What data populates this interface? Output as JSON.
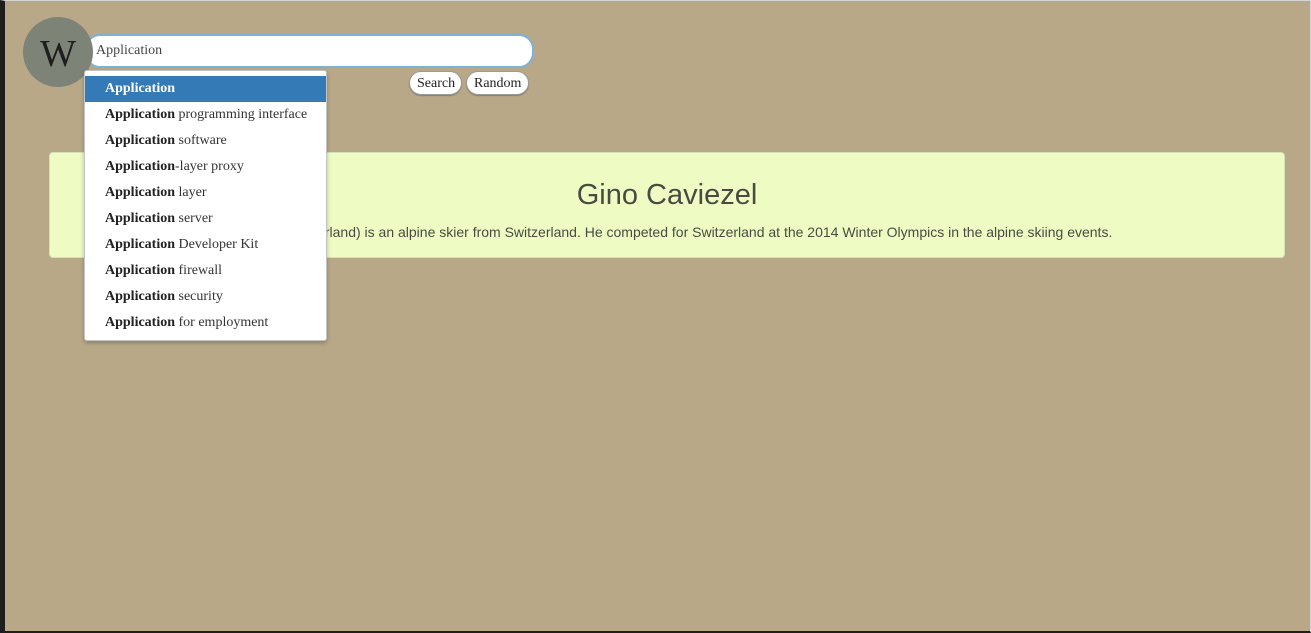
{
  "logo": {
    "letter": "W"
  },
  "search": {
    "value": "Application",
    "search_label": "Search",
    "random_label": "Random"
  },
  "autocomplete": {
    "items": [
      {
        "match": "Application",
        "rest": "",
        "active": true
      },
      {
        "match": "Application",
        "rest": " programming interface"
      },
      {
        "match": "Application",
        "rest": " software"
      },
      {
        "match": "Application",
        "rest": "-layer proxy"
      },
      {
        "match": "Application",
        "rest": " layer"
      },
      {
        "match": "Application",
        "rest": " server"
      },
      {
        "match": "Application",
        "rest": " Developer Kit"
      },
      {
        "match": "Application",
        "rest": " firewall"
      },
      {
        "match": "Application",
        "rest": " security"
      },
      {
        "match": "Application",
        "rest": " for employment"
      }
    ]
  },
  "result": {
    "title": "Gino Caviezel",
    "extract": "in Tomils, Switzerland) is an alpine skier from Switzerland. He competed for Switzerland at the 2014 Winter Olympics in the alpine skiing events."
  },
  "colors": {
    "background": "#b8a888",
    "card": "#eefcc3",
    "active_item": "#337ab7",
    "logo": "#7d8377"
  }
}
